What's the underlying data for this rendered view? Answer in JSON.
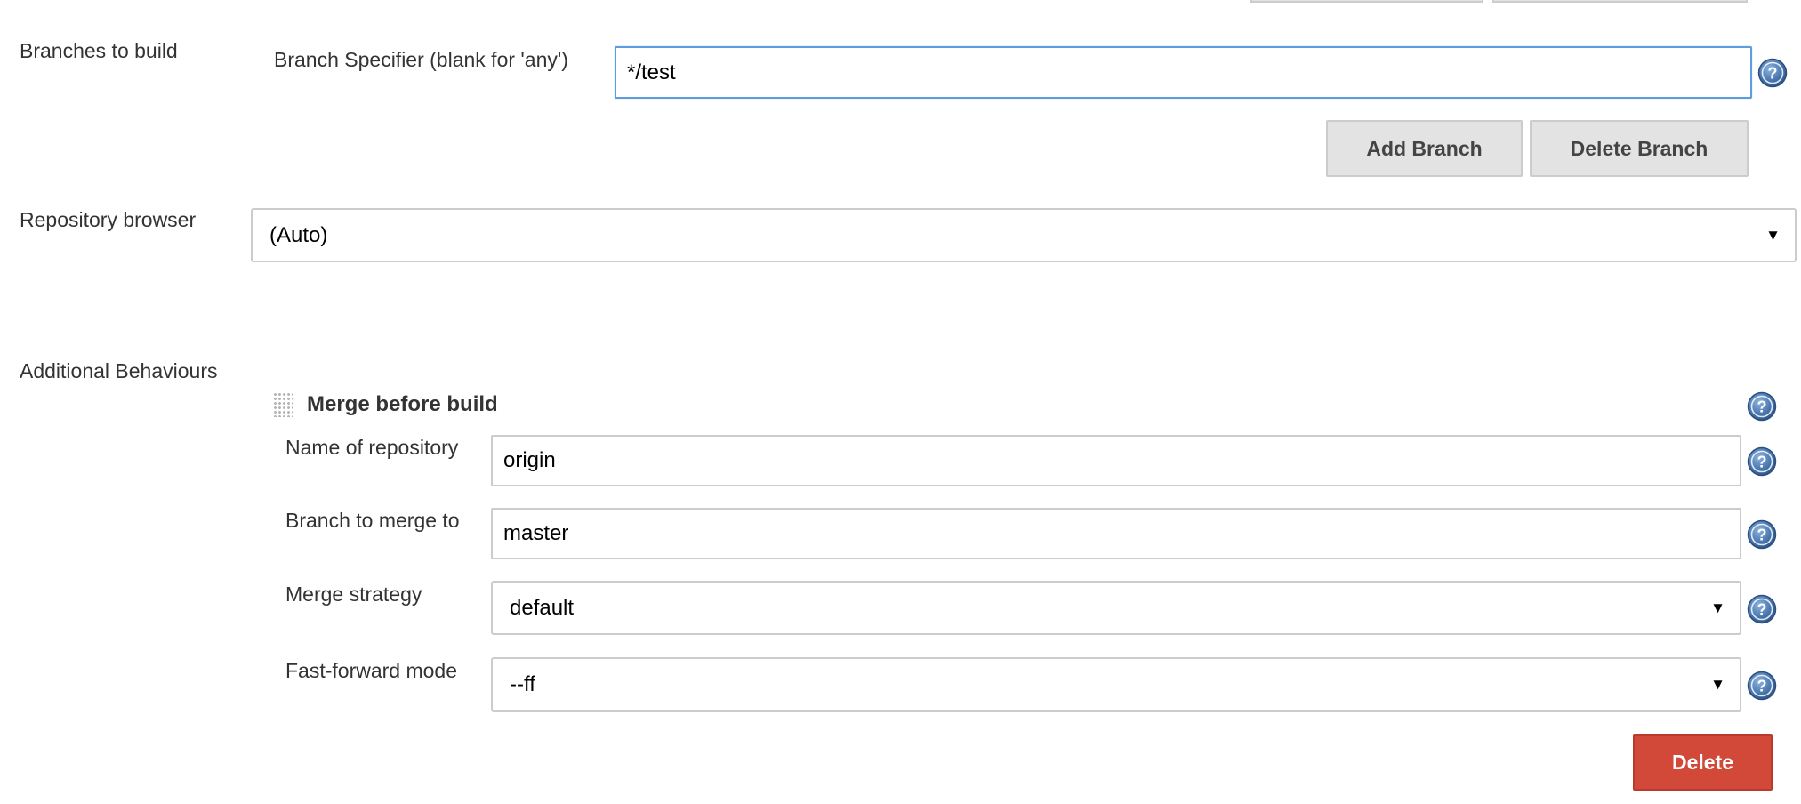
{
  "branches": {
    "section_label": "Branches to build",
    "specifier_label": "Branch Specifier (blank for 'any')",
    "specifier_value": "*/test",
    "add_branch_label": "Add Branch",
    "delete_branch_label": "Delete Branch"
  },
  "repository_browser": {
    "section_label": "Repository browser",
    "selected": "(Auto)"
  },
  "additional_behaviours": {
    "section_label": "Additional Behaviours",
    "merge": {
      "title": "Merge before build",
      "repo_name_label": "Name of repository",
      "repo_name_value": "origin",
      "branch_label": "Branch to merge to",
      "branch_value": "master",
      "strategy_label": "Merge strategy",
      "strategy_selected": "default",
      "ff_label": "Fast-forward mode",
      "ff_selected": "--ff",
      "delete_label": "Delete"
    }
  },
  "icons": {
    "help": "help-icon",
    "caret": "caret-down-icon",
    "drag": "drag-handle-icon"
  },
  "colors": {
    "focus_border": "#5b9ddf",
    "danger": "#d24939",
    "help_blue": "#3e6ea8"
  }
}
